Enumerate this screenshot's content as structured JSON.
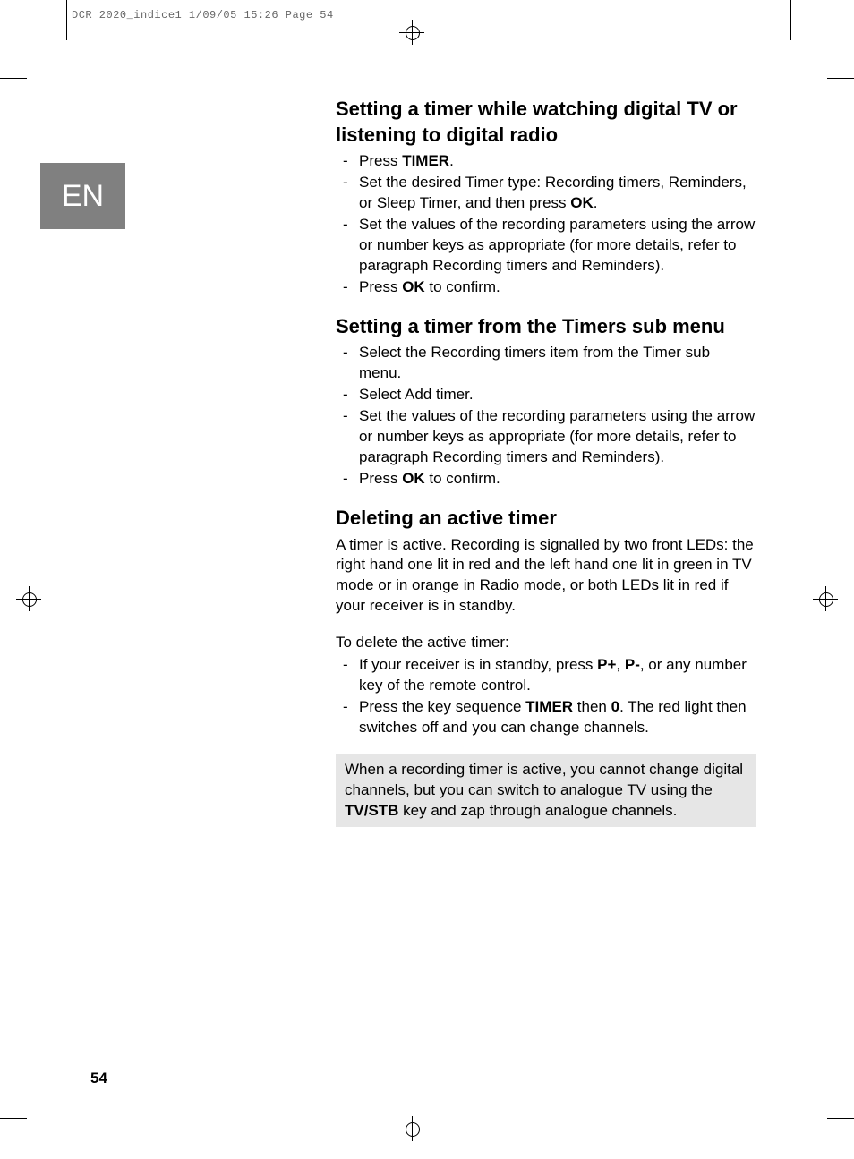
{
  "slug": "DCR 2020_indice1  1/09/05  15:26  Page 54",
  "lang_tab": "EN",
  "page_number": "54",
  "sections": [
    {
      "heading": "Setting a timer while watching digital TV or listening to digital radio",
      "items": [
        {
          "pre": "Press ",
          "b1": "TIMER",
          "post": "."
        },
        {
          "pre": "Set the desired Timer type: Recording timers, Reminders, or Sleep Timer, and then press ",
          "b1": "OK",
          "post": "."
        },
        {
          "pre": "Set the values of the recording parameters using the arrow or number keys as appropriate (for more details, refer to paragraph Recording timers and Reminders).",
          "b1": "",
          "post": ""
        },
        {
          "pre": "Press ",
          "b1": "OK",
          "post": " to confirm."
        }
      ]
    },
    {
      "heading": "Setting a timer from the Timers sub menu",
      "items": [
        {
          "pre": "Select the Recording timers item from the Timer sub menu.",
          "b1": "",
          "post": ""
        },
        {
          "pre": "Select Add timer.",
          "b1": "",
          "post": ""
        },
        {
          "pre": "Set the values of the recording parameters using the arrow or number keys as appropriate (for more details, refer to paragraph Recording timers and Reminders).",
          "b1": "",
          "post": ""
        },
        {
          "pre": "Press ",
          "b1": "OK",
          "post": " to confirm."
        }
      ]
    }
  ],
  "section3": {
    "heading": "Deleting an active timer",
    "para1": "A timer is active. Recording is signalled by two front LEDs: the right hand one lit in red and the left hand one lit in green in TV mode or in orange in Radio mode, or both LEDs lit in red if your receiver is in standby.",
    "para2": "To delete the active timer:",
    "items": [
      {
        "t1": "If your receiver is in standby, press ",
        "b1": "P+",
        "t2": ", ",
        "b2": "P-",
        "t3": ", or any number key of the remote control.",
        "b3": "",
        "t4": ""
      },
      {
        "t1": "Press the key sequence ",
        "b1": "TIMER",
        "t2": " then ",
        "b2": "0",
        "t3": ". The red light then switches off and you can change channels.",
        "b3": "",
        "t4": ""
      }
    ]
  },
  "note": {
    "t1": "When a recording timer is active, you cannot change digital channels, but you can switch to analogue TV using the ",
    "b1": "TV/STB",
    "t2": " key and zap through analogue channels."
  }
}
